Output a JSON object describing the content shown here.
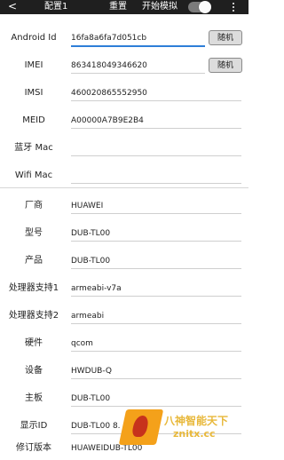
{
  "topbar": {
    "back_glyph": "<",
    "config_title": "配置1",
    "reset_label": "重置",
    "simulate_label": "开始模拟",
    "toggle_state": "off"
  },
  "device_fields": [
    {
      "label": "Android Id",
      "value": "16fa8a6fa7d051cb",
      "button": "随机"
    },
    {
      "label": "IMEI",
      "value": "863418049346620",
      "button": "随机"
    },
    {
      "label": "IMSI",
      "value": "460020865552950"
    },
    {
      "label": "MEID",
      "value": "A00000A7B9E2B4"
    },
    {
      "label": "蓝牙 Mac",
      "value": ""
    },
    {
      "label": "Wifi Mac",
      "value": ""
    }
  ],
  "build_fields": [
    {
      "label": "厂商",
      "value": "HUAWEI"
    },
    {
      "label": "型号",
      "value": "DUB-TL00"
    },
    {
      "label": "产品",
      "value": "DUB-TL00"
    },
    {
      "label": "处理器支持1",
      "value": "armeabi-v7a"
    },
    {
      "label": "处理器支持2",
      "value": "armeabi"
    },
    {
      "label": "硬件",
      "value": "qcom"
    },
    {
      "label": "设备",
      "value": "HWDUB-Q"
    },
    {
      "label": "主板",
      "value": "DUB-TL00"
    },
    {
      "label": "显示ID",
      "value": "DUB-TL00 8."
    },
    {
      "label": "修订版本",
      "value": "HUAWEIDUB-TL00"
    }
  ],
  "watermark": {
    "line1": "八神智能天下",
    "line2": "znitx.cc"
  },
  "colors": {
    "accent": "#2e7fd8",
    "topbar": "#1f1f1f",
    "watermark": "#f4a11a"
  }
}
